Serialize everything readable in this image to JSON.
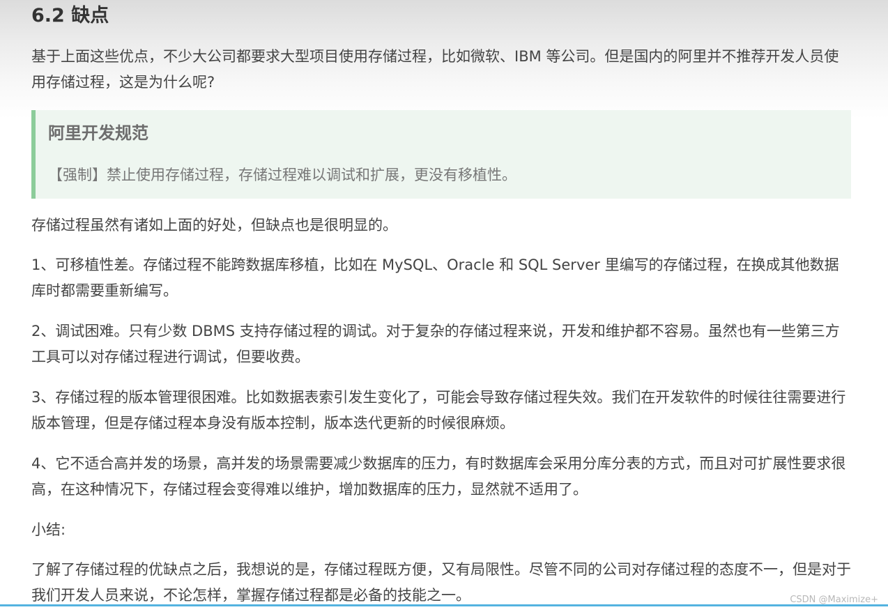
{
  "section": {
    "heading": "6.2 缺点",
    "intro": "基于上面这些优点，不少大公司都要求大型项目使用存储过程，比如微软、IBM 等公司。但是国内的阿里并不推荐开发人员使用存储过程，这是为什么呢?",
    "blockquote": {
      "title": "阿里开发规范",
      "text": "【强制】禁止使用存储过程，存储过程难以调试和扩展，更没有移植性。"
    },
    "paragraphs": [
      "存储过程虽然有诸如上面的好处，但缺点也是很明显的。",
      "1、可移植性差。存储过程不能跨数据库移植，比如在 MySQL、Oracle 和 SQL Server 里编写的存储过程，在换成其他数据库时都需要重新编写。",
      "2、调试困难。只有少数 DBMS 支持存储过程的调试。对于复杂的存储过程来说，开发和维护都不容易。虽然也有一些第三方工具可以对存储过程进行调试，但要收费。",
      "3、存储过程的版本管理很困难。比如数据表索引发生变化了，可能会导致存储过程失效。我们在开发软件的时候往往需要进行版本管理，但是存储过程本身没有版本控制，版本迭代更新的时候很麻烦。",
      "4、它不适合高并发的场景，高并发的场景需要减少数据库的压力，有时数据库会采用分库分表的方式，而且对可扩展性要求很高，在这种情况下，存储过程会变得难以维护，增加数据库的压力，显然就不适用了。",
      "小结:",
      "了解了存储过程的优缺点之后，我想说的是，存储过程既方便，又有局限性。尽管不同的公司对存储过程的态度不一，但是对于我们开发人员来说，不论怎样，掌握存储过程都是必备的技能之一。"
    ]
  },
  "watermark": "CSDN @Maximize+",
  "colors": {
    "quote_border": "#8ccc9a",
    "quote_bg": "#eef6f0",
    "bottom_line": "#54b3e0"
  }
}
